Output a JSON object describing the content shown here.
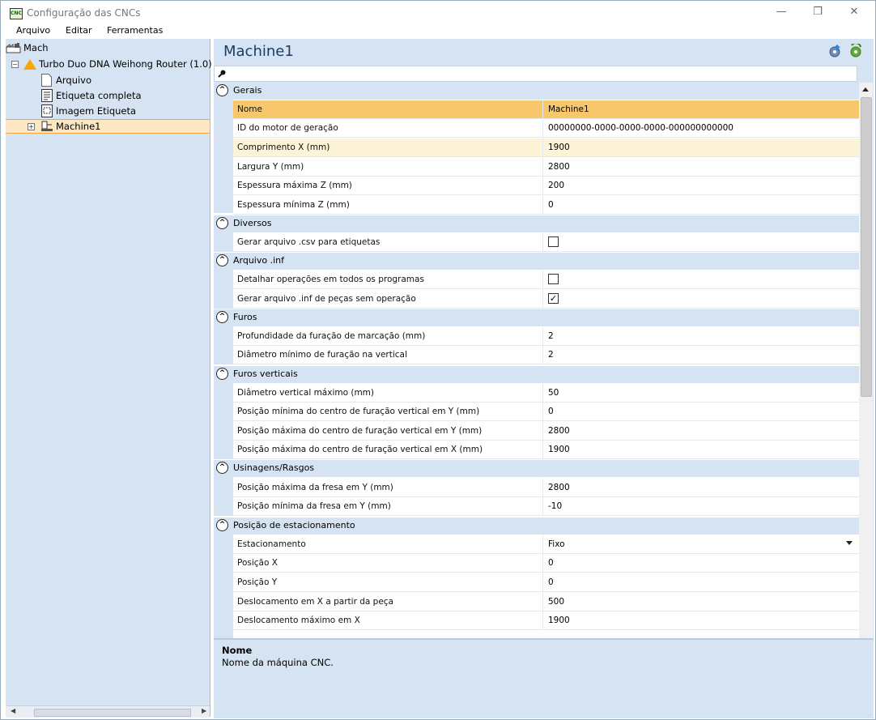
{
  "window": {
    "title": "Configuração das CNCs",
    "app_icon_text": "CNC"
  },
  "menu": [
    "Arquivo",
    "Editar",
    "Ferramentas"
  ],
  "tree": {
    "root": "Mach",
    "machine_type": "Turbo Duo DNA Weihong Router (1.0)",
    "children": [
      "Arquivo",
      "Etiqueta completa",
      "Imagem Etiqueta"
    ],
    "selected": "Machine1"
  },
  "main": {
    "title": "Machine1",
    "categories": [
      {
        "label": "Gerais",
        "rows": [
          {
            "name": "Nome",
            "value": "Machine1"
          },
          {
            "name": "ID do motor de geração",
            "value": "00000000-0000-0000-0000-000000000000"
          },
          {
            "name": "Comprimento X (mm)",
            "value": "1900"
          },
          {
            "name": "Largura Y (mm)",
            "value": "2800"
          },
          {
            "name": "Espessura máxima Z (mm)",
            "value": "200"
          },
          {
            "name": "Espessura mínima Z (mm)",
            "value": "0"
          }
        ]
      },
      {
        "label": "Diversos",
        "rows": [
          {
            "name": "Gerar arquivo .csv para etiquetas",
            "checked": false
          }
        ]
      },
      {
        "label": "Arquivo .inf",
        "rows": [
          {
            "name": "Detalhar operações em todos os programas",
            "checked": false
          },
          {
            "name": "Gerar arquivo .inf de peças sem operação",
            "checked": true
          }
        ]
      },
      {
        "label": "Furos",
        "rows": [
          {
            "name": "Profundidade da furação de marcação (mm)",
            "value": "2"
          },
          {
            "name": "Diâmetro mínimo de furação na vertical",
            "value": "2"
          }
        ]
      },
      {
        "label": "Furos verticais",
        "rows": [
          {
            "name": "Diâmetro vertical máximo (mm)",
            "value": "50"
          },
          {
            "name": "Posição mínima do centro de furação vertical em Y (mm)",
            "value": "0"
          },
          {
            "name": "Posição máxima do centro de furação vertical em Y (mm)",
            "value": "2800"
          },
          {
            "name": "Posição máxima do centro de furação vertical em X (mm)",
            "value": "1900"
          }
        ]
      },
      {
        "label": "Usinagens/Rasgos",
        "rows": [
          {
            "name": "Posição máxima da fresa em Y (mm)",
            "value": "2800"
          },
          {
            "name": "Posição mínima da fresa em Y (mm)",
            "value": "-10"
          }
        ]
      },
      {
        "label": "Posição de estacionamento",
        "rows": [
          {
            "name": "Estacionamento",
            "value": "Fixo"
          },
          {
            "name": "Posição X",
            "value": "0"
          },
          {
            "name": "Posição Y",
            "value": "0"
          },
          {
            "name": "Deslocamento em X a partir da peça",
            "value": "500"
          },
          {
            "name": "Deslocamento máximo em X",
            "value": "1900"
          }
        ]
      }
    ]
  },
  "description": {
    "title": "Nome",
    "text": "Nome da máquina CNC."
  }
}
